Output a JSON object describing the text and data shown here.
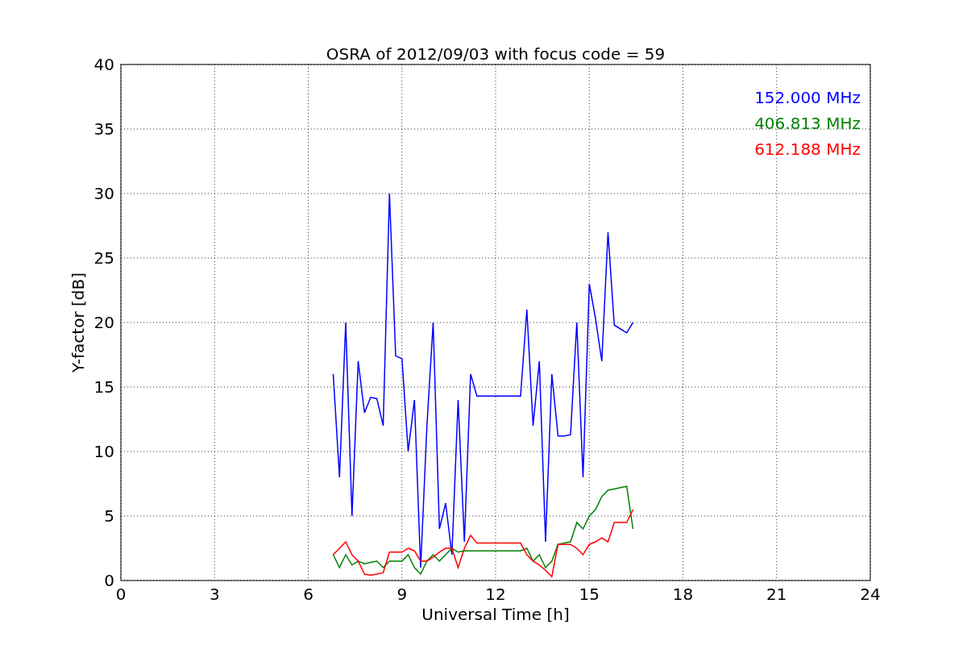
{
  "figure": {
    "chart_data": {
      "type": "line",
      "title": "OSRA of 2012/09/03 with focus code = 59",
      "xlabel": "Universal Time [h]",
      "ylabel": "Y-factor [dB]",
      "x": [
        6.8,
        7.0,
        7.2,
        7.4,
        7.6,
        7.8,
        8.0,
        8.2,
        8.4,
        8.6,
        8.8,
        9.0,
        9.2,
        9.4,
        9.6,
        9.8,
        10.0,
        10.2,
        10.4,
        10.6,
        10.8,
        11.0,
        11.2,
        11.4,
        11.6,
        11.8,
        12.0,
        12.2,
        12.4,
        12.6,
        12.8,
        13.0,
        13.2,
        13.4,
        13.6,
        13.8,
        14.0,
        14.2,
        14.4,
        14.6,
        14.8,
        15.0,
        15.2,
        15.4,
        15.6,
        15.8,
        16.0,
        16.2,
        16.4
      ],
      "series": [
        {
          "name": "152.000 MHz",
          "color": "#0000ff",
          "values": [
            16,
            8,
            20,
            5,
            17,
            13,
            14.2,
            14.1,
            12,
            30,
            17.4,
            17.2,
            10,
            14,
            1,
            12,
            20,
            4,
            6,
            2,
            14,
            3,
            16,
            14.3,
            14.3,
            14.3,
            14.3,
            14.3,
            14.3,
            14.3,
            14.3,
            21,
            12,
            17,
            3,
            16,
            11.2,
            11.2,
            11.3,
            20,
            8,
            23,
            20.3,
            17,
            27,
            19.8,
            19.5,
            19.2,
            20
          ]
        },
        {
          "name": "406.813 MHz",
          "color": "#008000",
          "values": [
            2,
            1,
            2,
            1.2,
            1.5,
            1.3,
            1.4,
            1.5,
            1,
            1.5,
            1.5,
            1.5,
            2,
            1,
            0.5,
            1.5,
            2,
            1.5,
            2,
            2.5,
            2.2,
            2.3,
            2.3,
            2.3,
            2.3,
            2.3,
            2.3,
            2.3,
            2.3,
            2.3,
            2.3,
            2.5,
            1.5,
            2,
            1,
            1.5,
            2.8,
            2.9,
            3,
            4.5,
            4,
            5,
            5.5,
            6.5,
            7,
            7.1,
            7.2,
            7.3,
            4
          ]
        },
        {
          "name": "612.188 MHz",
          "color": "#ff0000",
          "values": [
            2,
            2.5,
            3,
            2,
            1.5,
            0.5,
            0.4,
            0.5,
            0.6,
            2.2,
            2.2,
            2.2,
            2.5,
            2.3,
            1.5,
            1.5,
            1.8,
            2.2,
            2.5,
            2.5,
            1,
            2.5,
            3.5,
            2.9,
            2.9,
            2.9,
            2.9,
            2.9,
            2.9,
            2.9,
            2.9,
            2,
            1.5,
            1.2,
            0.8,
            0.3,
            2.8,
            2.8,
            2.8,
            2.5,
            2,
            2.8,
            3,
            3.3,
            3,
            4.5,
            4.5,
            4.5,
            5.5
          ]
        }
      ],
      "xlim": [
        0,
        24
      ],
      "ylim": [
        0,
        40
      ],
      "xticks": [
        0,
        3,
        6,
        9,
        12,
        15,
        18,
        21,
        24
      ],
      "yticks": [
        0,
        5,
        10,
        15,
        20,
        25,
        30,
        35,
        40
      ],
      "grid": true
    }
  }
}
